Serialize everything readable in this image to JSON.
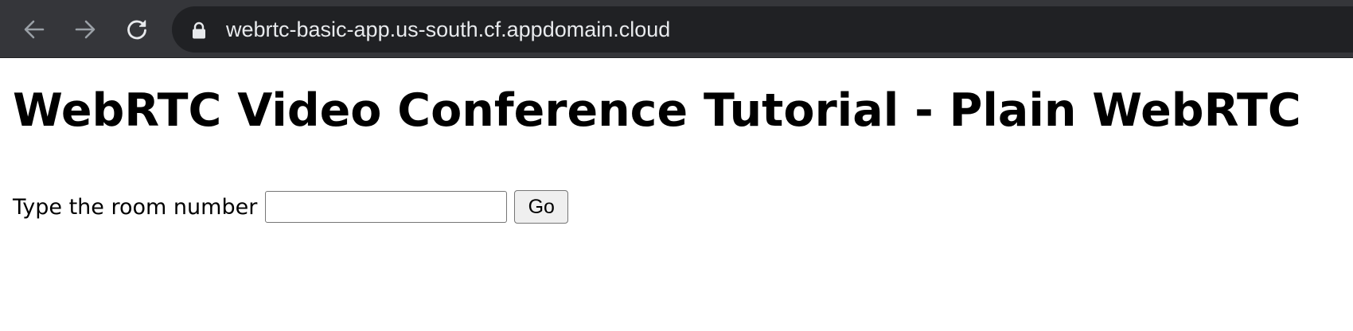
{
  "browser": {
    "url": "webrtc-basic-app.us-south.cf.appdomain.cloud",
    "icons": {
      "back": "arrow-left-icon",
      "forward": "arrow-right-icon",
      "reload": "reload-icon",
      "lock": "lock-icon"
    },
    "colors": {
      "toolbar": "#35363a",
      "omnibox": "#202124",
      "url_text": "#e8eaed"
    }
  },
  "page": {
    "title": "WebRTC Video Conference Tutorial - Plain WebRTC",
    "room_label": "Type the room number",
    "room_input_value": "",
    "go_label": "Go"
  }
}
